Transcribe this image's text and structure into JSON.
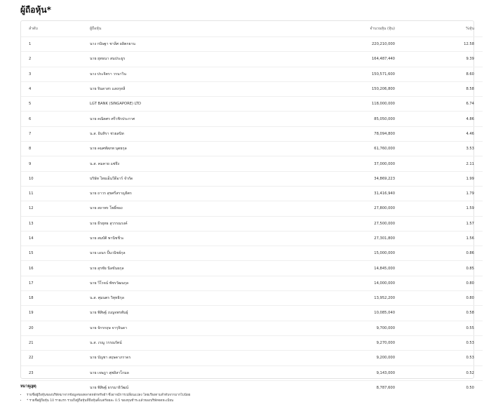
{
  "page": {
    "title": "ผู้ถือหุ้น*"
  },
  "table": {
    "headers": [
      "ลำดับ",
      "ผู้ถือหุ้น",
      "จำนวนหุ้น (หุ้น)",
      "%หุ้น"
    ],
    "rows": [
      [
        "1",
        "นาง กนิษฐา ชาลีศ ผลิตกยาน",
        "220,210,000",
        "12.58"
      ],
      [
        "2",
        "นาย ยุทธนา สนประยูร",
        "164,487,440",
        "9.39"
      ],
      [
        "3",
        "นาง ประจิตรา วรนาวิน",
        "150,571,600",
        "8.60"
      ],
      [
        "4",
        "นาย จินดาสร แสงกุหลี",
        "150,206,800",
        "8.58"
      ],
      [
        "5",
        "LGT BANK (SINGAPORE) LTD",
        "118,000,000",
        "6.74"
      ],
      [
        "6",
        "นาย คณิตศร ศรีวชิรประกาศ",
        "85,050,000",
        "4.86"
      ],
      [
        "7",
        "น.ส. อินทิรา ช่วยสนิท",
        "78,094,800",
        "4.46"
      ],
      [
        "8",
        "นาย คมศพัสภพ นุตยกุล",
        "61,760,000",
        "3.53"
      ],
      [
        "9",
        "น.ส. คมคาย แซ่จึง",
        "37,000,000",
        "2.11"
      ],
      [
        "10",
        "บริษัท ไทยเอ็นวีดีอาร์ จำกัด",
        "34,869,223",
        "1.99"
      ],
      [
        "11",
        "นาย ถาวร สุขศรีสราญจิตร",
        "31,416,940",
        "1.79"
      ],
      [
        "12",
        "นาย สถาพร โพธิ์ทอง",
        "27,800,000",
        "1.59"
      ],
      [
        "13",
        "นาย ธีรยุทธ สุวรรณรงค์",
        "27,500,000",
        "1.57"
      ],
      [
        "14",
        "นาย สมบัติ พานิชชีวะ",
        "27,301,800",
        "1.56"
      ],
      [
        "15",
        "นาย เอนก ปั้นวนิชย์กุล",
        "15,000,000",
        "0.86"
      ],
      [
        "16",
        "นาย สุรชัย นิลขันธกุล",
        "14,845,000",
        "0.85"
      ],
      [
        "17",
        "นาย วีโรจน์ พัชรวัฒนกุล",
        "14,000,000",
        "0.80"
      ],
      [
        "18",
        "น.ส. ศุมนตร วิทุทธิกุล",
        "13,952,200",
        "0.80"
      ],
      [
        "19",
        "นาย พิสิษฐ์ เบญจพรพันธุ์",
        "10,085,040",
        "0.58"
      ],
      [
        "20",
        "นาย จักรกฤษ จารุจินดา",
        "9,700,000",
        "0.55"
      ],
      [
        "21",
        "น.ส. เรณู วรรณรัตน์",
        "9,270,000",
        "0.53"
      ],
      [
        "22",
        "นาย บัญชา สฤษดาภราดร",
        "9,200,000",
        "0.53"
      ],
      [
        "23",
        "นาย เจษฎา สุพลิสาโกมล",
        "9,143,000",
        "0.52"
      ],
      [
        "24",
        "นาย พิสิษฐ์ ธรรมาธิวัฒน์",
        "8,787,600",
        "0.50"
      ]
    ]
  },
  "notes": {
    "title": "หมายเหตุ",
    "items": [
      "รายชื่อผู้ถือหุ้นของบริษัทมาจากข้อมูลของตลาดหลักทรัพย์ฯ ซึ่งอาจมีการเปลี่ยนแปลง โดยเรียงตามลำดับจากมากไปน้อย",
      "* รายชื่อผู้ถือหุ้น 10 รายแรก รวมถึงผู้ถือหุ้นที่ถือหุ้นตั้งแต่ร้อยละ 0.5 ของทุนชำระแล้วของบริษัทจดทะเบียน"
    ]
  }
}
